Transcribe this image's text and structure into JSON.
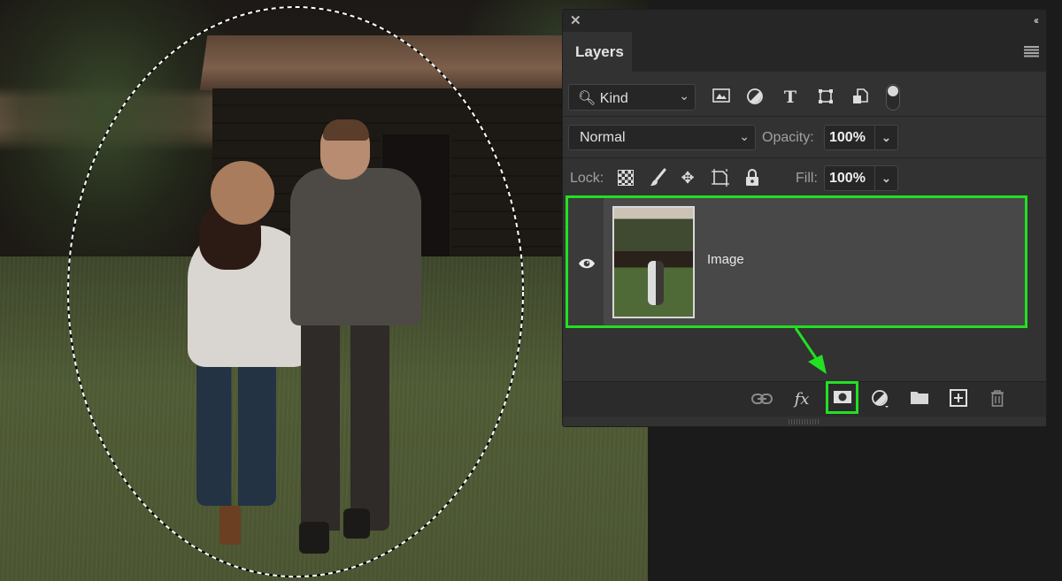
{
  "canvas": {
    "description": "Photo of a couple walking on grass toward a dark barn, with an elliptical marquee selection",
    "selection_shape": "ellipse"
  },
  "panel": {
    "close_icon": "✕",
    "collapse_icon": "‹‹",
    "tab_label": "Layers",
    "menu_icon": "hamburger-menu",
    "filter": {
      "kind_label": "Kind",
      "icons": [
        "pixel-layer-filter",
        "adjustment-layer-filter",
        "type-layer-filter",
        "shape-layer-filter",
        "smart-object-filter"
      ],
      "toggle_on": true
    },
    "blend_mode": "Normal",
    "opacity_label": "Opacity:",
    "opacity_value": "100%",
    "lock_label": "Lock:",
    "lock_icons": [
      "lock-transparent-pixels",
      "lock-image-pixels",
      "lock-position",
      "lock-artboard",
      "lock-all"
    ],
    "fill_label": "Fill:",
    "fill_value": "100%",
    "layers": [
      {
        "name": "Image",
        "visible": true,
        "selected": true
      }
    ],
    "bottom_icons": [
      "link-layers",
      "fx",
      "add-layer-mask",
      "new-fill-adjustment-layer",
      "new-group",
      "new-layer",
      "delete-layer"
    ],
    "fx_label": "fx"
  },
  "annotation": {
    "highlight_color": "#22e022",
    "highlighted_items": [
      "layer-image",
      "add-layer-mask-button"
    ]
  }
}
